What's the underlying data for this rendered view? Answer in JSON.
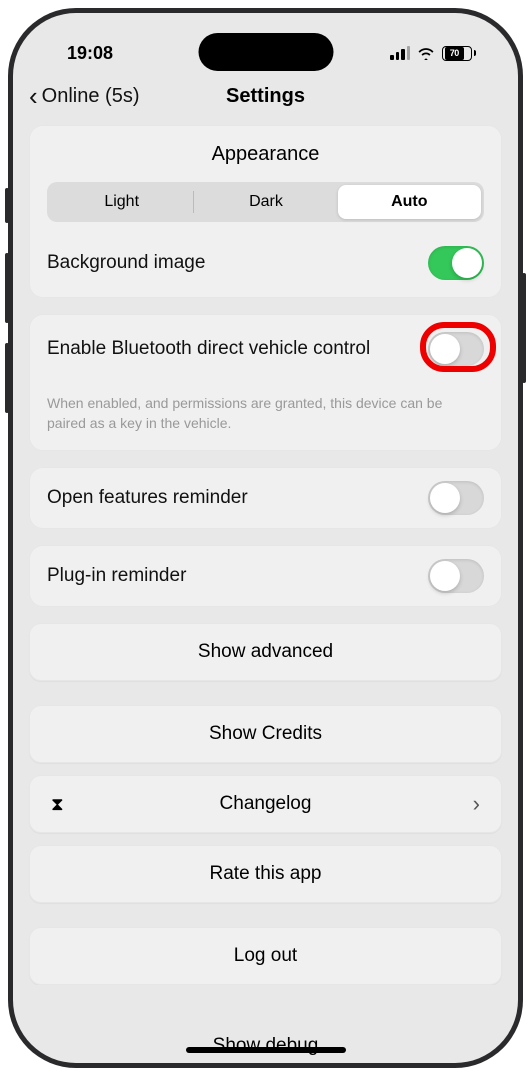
{
  "status": {
    "time": "19:08",
    "battery": "70"
  },
  "nav": {
    "back_label": "Online (5s)",
    "title": "Settings"
  },
  "appearance": {
    "title": "Appearance",
    "light": "Light",
    "dark": "Dark",
    "auto": "Auto",
    "bgimage_label": "Background image"
  },
  "bluetooth": {
    "label": "Enable Bluetooth direct vehicle control",
    "help": "When enabled, and permissions are granted, this device can be paired as a key in the vehicle."
  },
  "reminders": {
    "open_features": "Open features reminder",
    "plugin": "Plug-in reminder"
  },
  "buttons": {
    "show_advanced": "Show advanced",
    "show_credits": "Show Credits",
    "changelog": "Changelog",
    "rate": "Rate this app",
    "logout": "Log out",
    "show_debug": "Show debug"
  }
}
